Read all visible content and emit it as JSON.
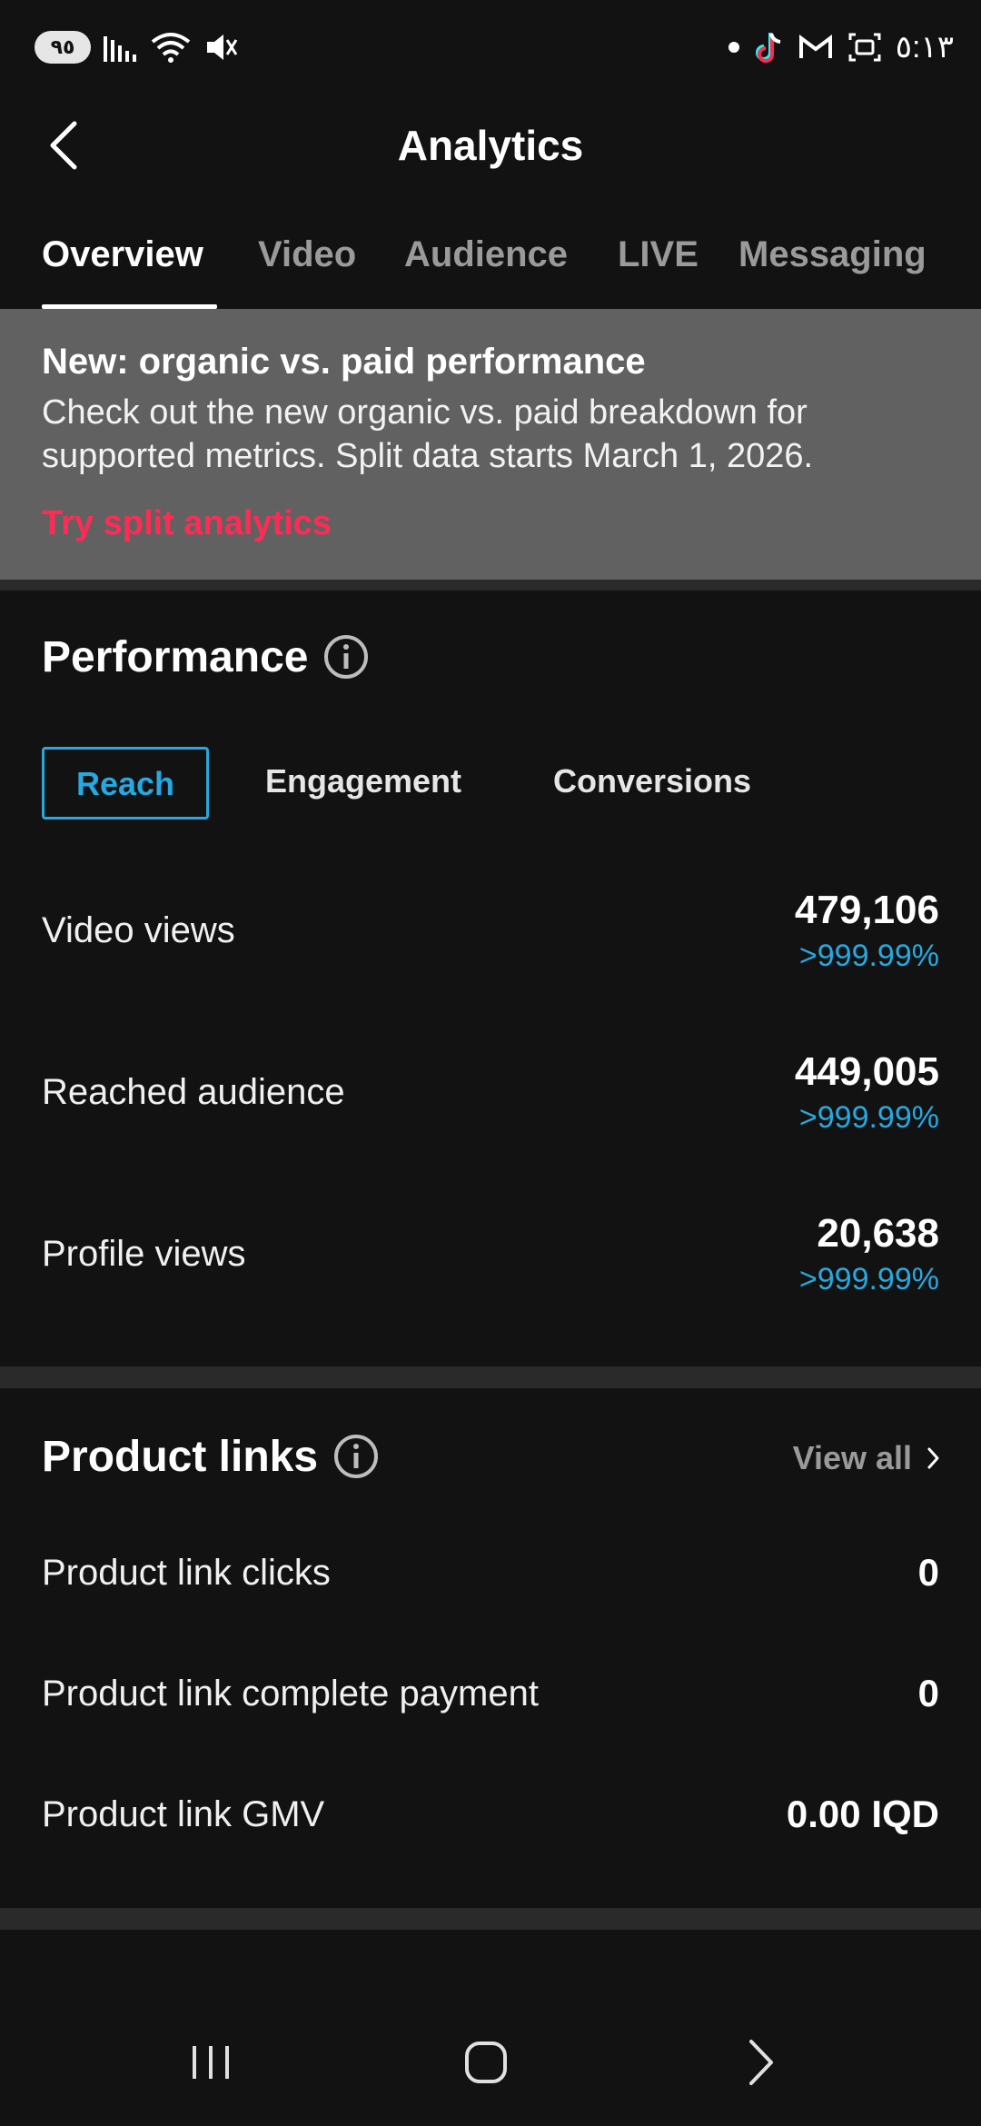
{
  "status_bar": {
    "battery": "٩٥",
    "time": "٥:١٣"
  },
  "header": {
    "title": "Analytics"
  },
  "tabs": [
    {
      "label": "Overview",
      "active": true
    },
    {
      "label": "Video",
      "active": false
    },
    {
      "label": "Audience",
      "active": false
    },
    {
      "label": "LIVE",
      "active": false
    },
    {
      "label": "Messaging",
      "active": false
    }
  ],
  "banner": {
    "title": "New: organic vs. paid performance",
    "text": "Check out the new organic vs. paid breakdown for supported metrics. Split data starts March 1, 2026.",
    "link": "Try split analytics"
  },
  "performance": {
    "title": "Performance",
    "segments": [
      "Reach",
      "Engagement",
      "Conversions"
    ],
    "active_segment": "Reach",
    "metrics": [
      {
        "label": "Video views",
        "value": "479,106",
        "change": ">999.99%"
      },
      {
        "label": "Reached audience",
        "value": "449,005",
        "change": ">999.99%"
      },
      {
        "label": "Profile views",
        "value": "20,638",
        "change": ">999.99%"
      }
    ]
  },
  "product_links": {
    "title": "Product links",
    "view_all": "View all",
    "rows": [
      {
        "label": "Product link clicks",
        "value": "0"
      },
      {
        "label": "Product link complete payment",
        "value": "0"
      },
      {
        "label": "Product link GMV",
        "value": "0.00 IQD"
      }
    ]
  },
  "colors": {
    "accent": "#25a9e0",
    "link": "#fe2c55",
    "background": "#121212",
    "banner": "#616161"
  }
}
